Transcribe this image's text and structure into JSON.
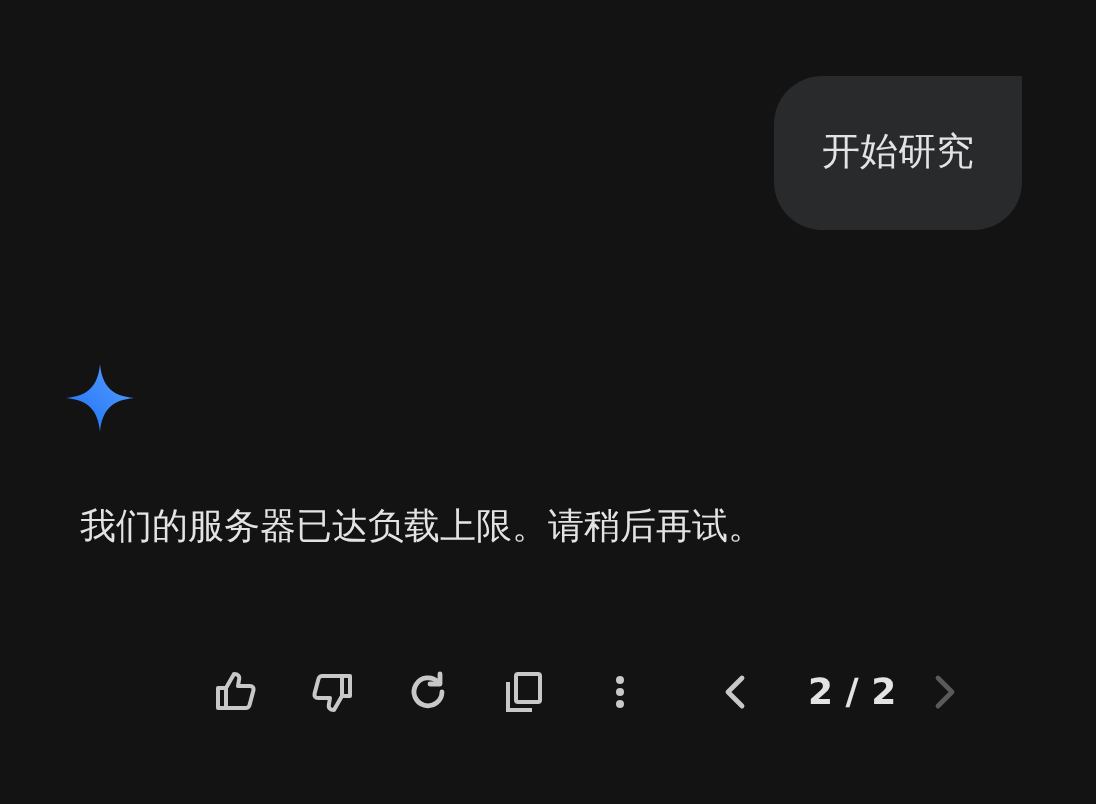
{
  "user_message": {
    "text": "开始研究"
  },
  "response": {
    "text": "我们的服务器已达负载上限。请稍后再试。"
  },
  "actions": [
    {
      "kind": "thumb-up"
    },
    {
      "kind": "thumb-down"
    },
    {
      "kind": "redo"
    },
    {
      "kind": "copy"
    },
    {
      "kind": "more"
    }
  ],
  "pager": {
    "label": "2 / 2",
    "prev_disabled": false,
    "next_disabled": true
  }
}
